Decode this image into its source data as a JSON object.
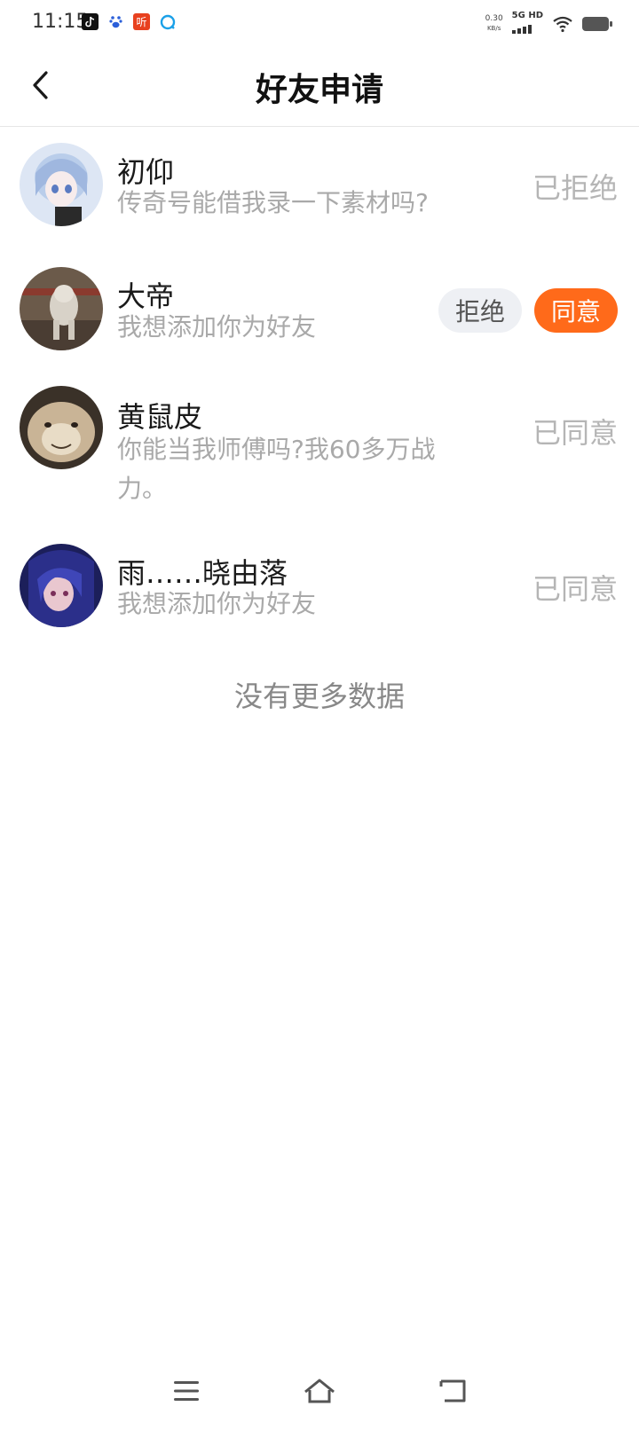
{
  "status_bar": {
    "time": "11:15",
    "net_speed": "0.30",
    "net_speed_unit": "KB/s",
    "net_type": "5G HD",
    "app_icons": [
      "douyin-icon",
      "baidu-icon",
      "ting-icon",
      "browser-icon"
    ],
    "ting_label": "听"
  },
  "header": {
    "title": "好友申请"
  },
  "requests": [
    {
      "name": "初仰",
      "message": "传奇号能借我录一下素材吗?",
      "status": "已拒绝"
    },
    {
      "name": "大帝",
      "message": "我想添加你为好友",
      "reject_label": "拒绝",
      "accept_label": "同意"
    },
    {
      "name": "黄鼠皮",
      "message": "你能当我师傅吗?我60多万战力。",
      "status": "已同意"
    },
    {
      "name": "雨……晓由落",
      "message": "我想添加你为好友",
      "status": "已同意"
    }
  ],
  "footer_note": "没有更多数据",
  "colors": {
    "accent": "#ff6a1a",
    "reject_bg": "#eef0f4",
    "muted_text": "#a9a9a9"
  }
}
